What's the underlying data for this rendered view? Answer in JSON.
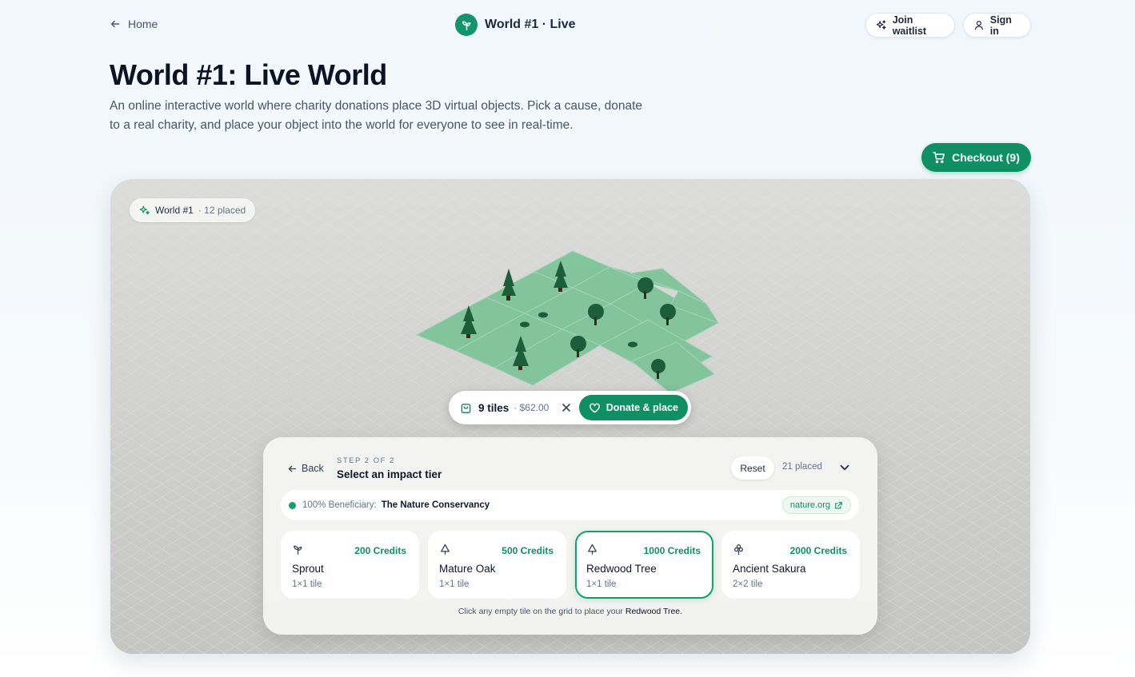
{
  "nav": {
    "home_label": "Home",
    "brand_title": "World #1 · Live",
    "waitlist_label": "Join waitlist",
    "signin_label": "Sign in"
  },
  "hero": {
    "title": "World #1: Live World",
    "description": "An online interactive world where charity donations place 3D virtual objects. Pick a cause, donate to a real charity, and place your object into the world for everyone to see in real-time.",
    "checkout_label": "Checkout (9)"
  },
  "world": {
    "badge_name": "World #1",
    "badge_count": "· 12 placed",
    "selection": {
      "tiles": "9 tiles",
      "amount": "· $62.00",
      "donate_label": "Donate & place"
    }
  },
  "panel": {
    "back_label": "Back",
    "step_label": "STEP 2 OF 2",
    "step_title": "Select an impact tier",
    "reset_label": "Reset",
    "placed_count": "21 placed",
    "beneficiary": {
      "label": "100% Beneficiary:",
      "name": "The Nature Conservancy",
      "link": "nature.org"
    },
    "tiers": [
      {
        "icon": "sprout-icon",
        "credits": "200 Credits",
        "name": "Sprout",
        "size": "1×1 tile"
      },
      {
        "icon": "tree-icon",
        "credits": "500 Credits",
        "name": "Mature Oak",
        "size": "1×1 tile"
      },
      {
        "icon": "tree-icon",
        "credits": "1000 Credits",
        "name": "Redwood Tree",
        "size": "1×1 tile",
        "selected": true
      },
      {
        "icon": "sakura-icon",
        "credits": "2000 Credits",
        "name": "Ancient Sakura",
        "size": "2×2 tile"
      }
    ],
    "hint_prefix": "Click any empty tile on the grid to place your",
    "hint_object": "Redwood Tree."
  },
  "colors": {
    "accent": "#0f8f63",
    "tile_green": "#7fc49a",
    "ground": "#cfcfcd"
  }
}
